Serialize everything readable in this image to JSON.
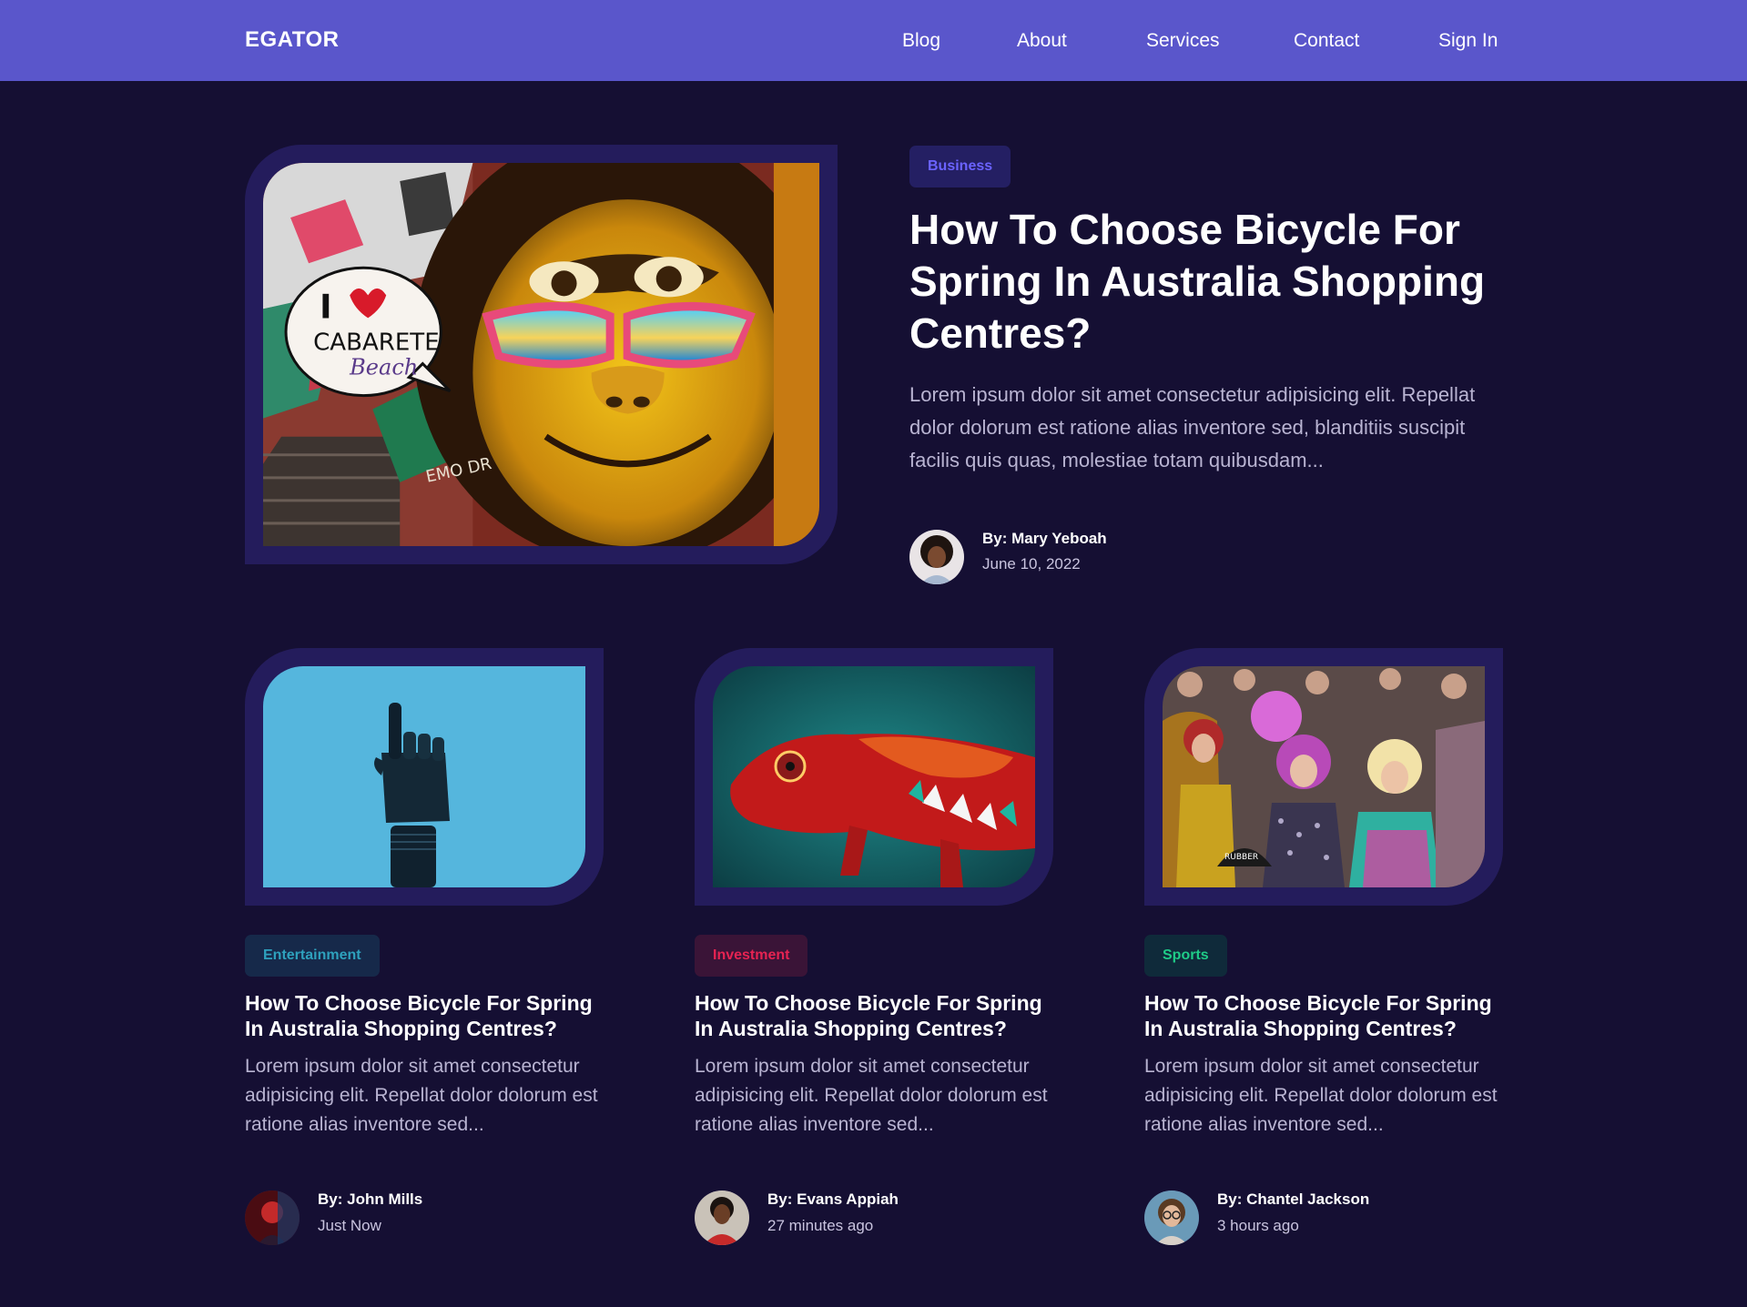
{
  "nav": {
    "brand": "EGATOR",
    "links": [
      "Blog",
      "About",
      "Services",
      "Contact",
      "Sign In"
    ]
  },
  "featured": {
    "category": "Business",
    "title": "How To Choose Bicycle For Spring In Australia Shopping Centres?",
    "excerpt": "Lorem ipsum dolor sit amet consectetur adipisicing elit. Repellat dolor dolorum est ratione alias inventore sed, blanditiis suscipit facilis quis quas, molestiae totam quibusdam...",
    "author": "By: Mary Yeboah",
    "date": "June 10, 2022",
    "image_text": {
      "bubble_i": "I",
      "bubble_city": "CABARETE",
      "bubble_beach": "Beach",
      "tag": "EMO DR"
    }
  },
  "cards": [
    {
      "category": "Entertainment",
      "category_color": "#2ea1bd",
      "category_bg": "#16294a",
      "title": "How To Choose Bicycle For Spring In Australia Shopping Centres?",
      "excerpt": "Lorem ipsum dolor sit amet consectetur adipisicing elit. Repellat dolor dolorum est ratione alias inventore sed...",
      "author": "By: John Mills",
      "time": "Just Now"
    },
    {
      "category": "Investment",
      "category_color": "#e62352",
      "category_bg": "#3a1437",
      "title": "How To Choose Bicycle For Spring In Australia Shopping Centres?",
      "excerpt": "Lorem ipsum dolor sit amet consectetur adipisicing elit. Repellat dolor dolorum est ratione alias inventore sed...",
      "author": "By: Evans Appiah",
      "time": "27 minutes ago"
    },
    {
      "category": "Sports",
      "category_color": "#1fcb87",
      "category_bg": "#0f2a3a",
      "title": "How To Choose Bicycle For Spring In Australia Shopping Centres?",
      "excerpt": "Lorem ipsum dolor sit amet consectetur adipisicing elit. Repellat dolor dolorum est ratione alias inventore sed...",
      "author": "By: Chantel Jackson",
      "time": "3 hours ago",
      "image_text": "RUBBER"
    }
  ],
  "colors": {
    "navbar": "#5a56cb",
    "background": "#150f33",
    "frame": "#241c5c",
    "business_badge_bg": "#241f63",
    "business_badge_text": "#6b63ff"
  }
}
